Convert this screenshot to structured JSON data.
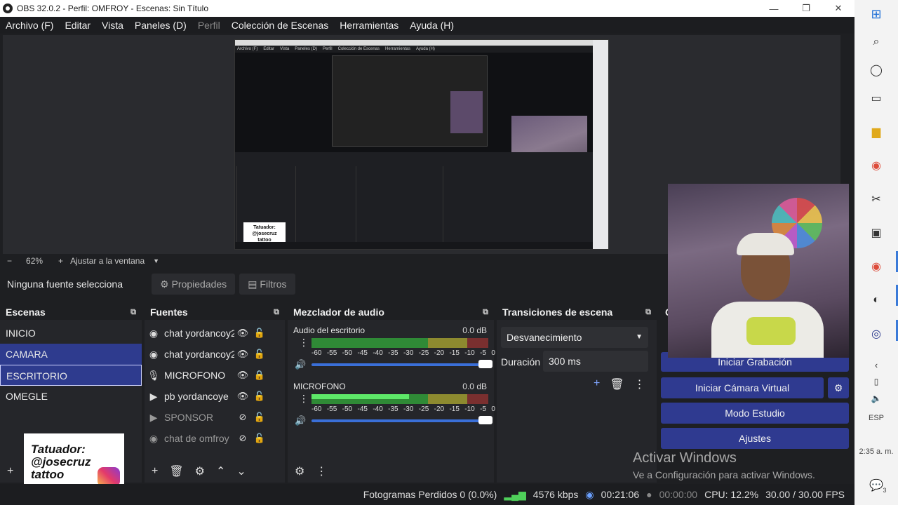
{
  "window": {
    "title": "OBS 32.0.2 - Perfil: OMFROY - Escenas: Sin Título"
  },
  "menu": {
    "items": [
      {
        "label": "Archivo (F)",
        "disabled": false
      },
      {
        "label": "Editar",
        "disabled": false
      },
      {
        "label": "Vista",
        "disabled": false
      },
      {
        "label": "Paneles (D)",
        "disabled": false
      },
      {
        "label": "Perfil",
        "disabled": true
      },
      {
        "label": "Colección de Escenas",
        "disabled": false
      },
      {
        "label": "Herramientas",
        "disabled": false
      },
      {
        "label": "Ayuda (H)",
        "disabled": false
      }
    ]
  },
  "zoom": {
    "minus": "−",
    "value": "62%",
    "plus": "+",
    "fit_label": "Ajustar a la ventana",
    "caret": "▼"
  },
  "source_toolbar": {
    "no_source": "Ninguna fuente selecciona",
    "properties": "Propiedades",
    "filters": "Filtros"
  },
  "scenes": {
    "title": "Escenas",
    "items": [
      {
        "label": "INICIO"
      },
      {
        "label": "CAMARA"
      },
      {
        "label": "ESCRITORIO"
      },
      {
        "label": "OMEGLE"
      }
    ]
  },
  "sources": {
    "title": "Fuentes",
    "items": [
      {
        "label": "chat yordancoy2",
        "icon": "globe-icon",
        "locked": false,
        "visible": true
      },
      {
        "label": "chat yordancoy2",
        "icon": "globe-icon",
        "locked": false,
        "visible": true
      },
      {
        "label": "MICROFONO",
        "icon": "microphone-icon",
        "locked": true,
        "visible": true
      },
      {
        "label": "pb yordancoye",
        "icon": "play-icon",
        "locked": false,
        "visible": true
      },
      {
        "label": "SPONSOR",
        "icon": "play-icon",
        "locked": false,
        "visible": false
      },
      {
        "label": "chat de omfroy",
        "icon": "globe-icon",
        "locked": false,
        "visible": false
      }
    ]
  },
  "mixer": {
    "title": "Mezclador de audio",
    "ticks": [
      "-60",
      "-55",
      "-50",
      "-45",
      "-40",
      "-35",
      "-30",
      "-25",
      "-20",
      "-15",
      "-10",
      "-5",
      "0"
    ],
    "channels": [
      {
        "name": "Audio del escritorio",
        "db": "0.0 dB",
        "level": 0.0
      },
      {
        "name": "MICROFONO",
        "db": "0.0 dB",
        "level": 0.55
      }
    ]
  },
  "transitions": {
    "title": "Transiciones de escena",
    "selected": "Desvanecimiento",
    "duration_label": "Duración",
    "duration_value": "300 ms"
  },
  "controls": {
    "title": "C",
    "start_recording": "Iniciar Grabación",
    "start_virtual_cam": "Iniciar Cámara Virtual",
    "studio_mode": "Modo Estudio",
    "settings": "Ajustes"
  },
  "watermark": {
    "line1": "Activar Windows",
    "line2": "Ve a Configuración para activar Windows."
  },
  "overlay": {
    "tattoo_text": "Tatuador:\n@josecruz\ntattoo"
  },
  "preview_mini": {
    "menu": [
      "Archivo (F)",
      "Editar",
      "Vista",
      "Paneles (D)",
      "Perfil",
      "Colección de Escenas",
      "Herramientas",
      "Ayuda (H)"
    ]
  },
  "status": {
    "dropped": "Fotogramas Perdidos 0 (0.0%)",
    "bitrate": "4576 kbps",
    "stream_time": "00:21:06",
    "rec_time": "00:00:00",
    "cpu": "CPU: 12.2%",
    "fps": "30.00 / 30.00 FPS"
  },
  "taskbar": {
    "lang": "ESP",
    "time": "2:35 a. m.",
    "notif": "3"
  }
}
